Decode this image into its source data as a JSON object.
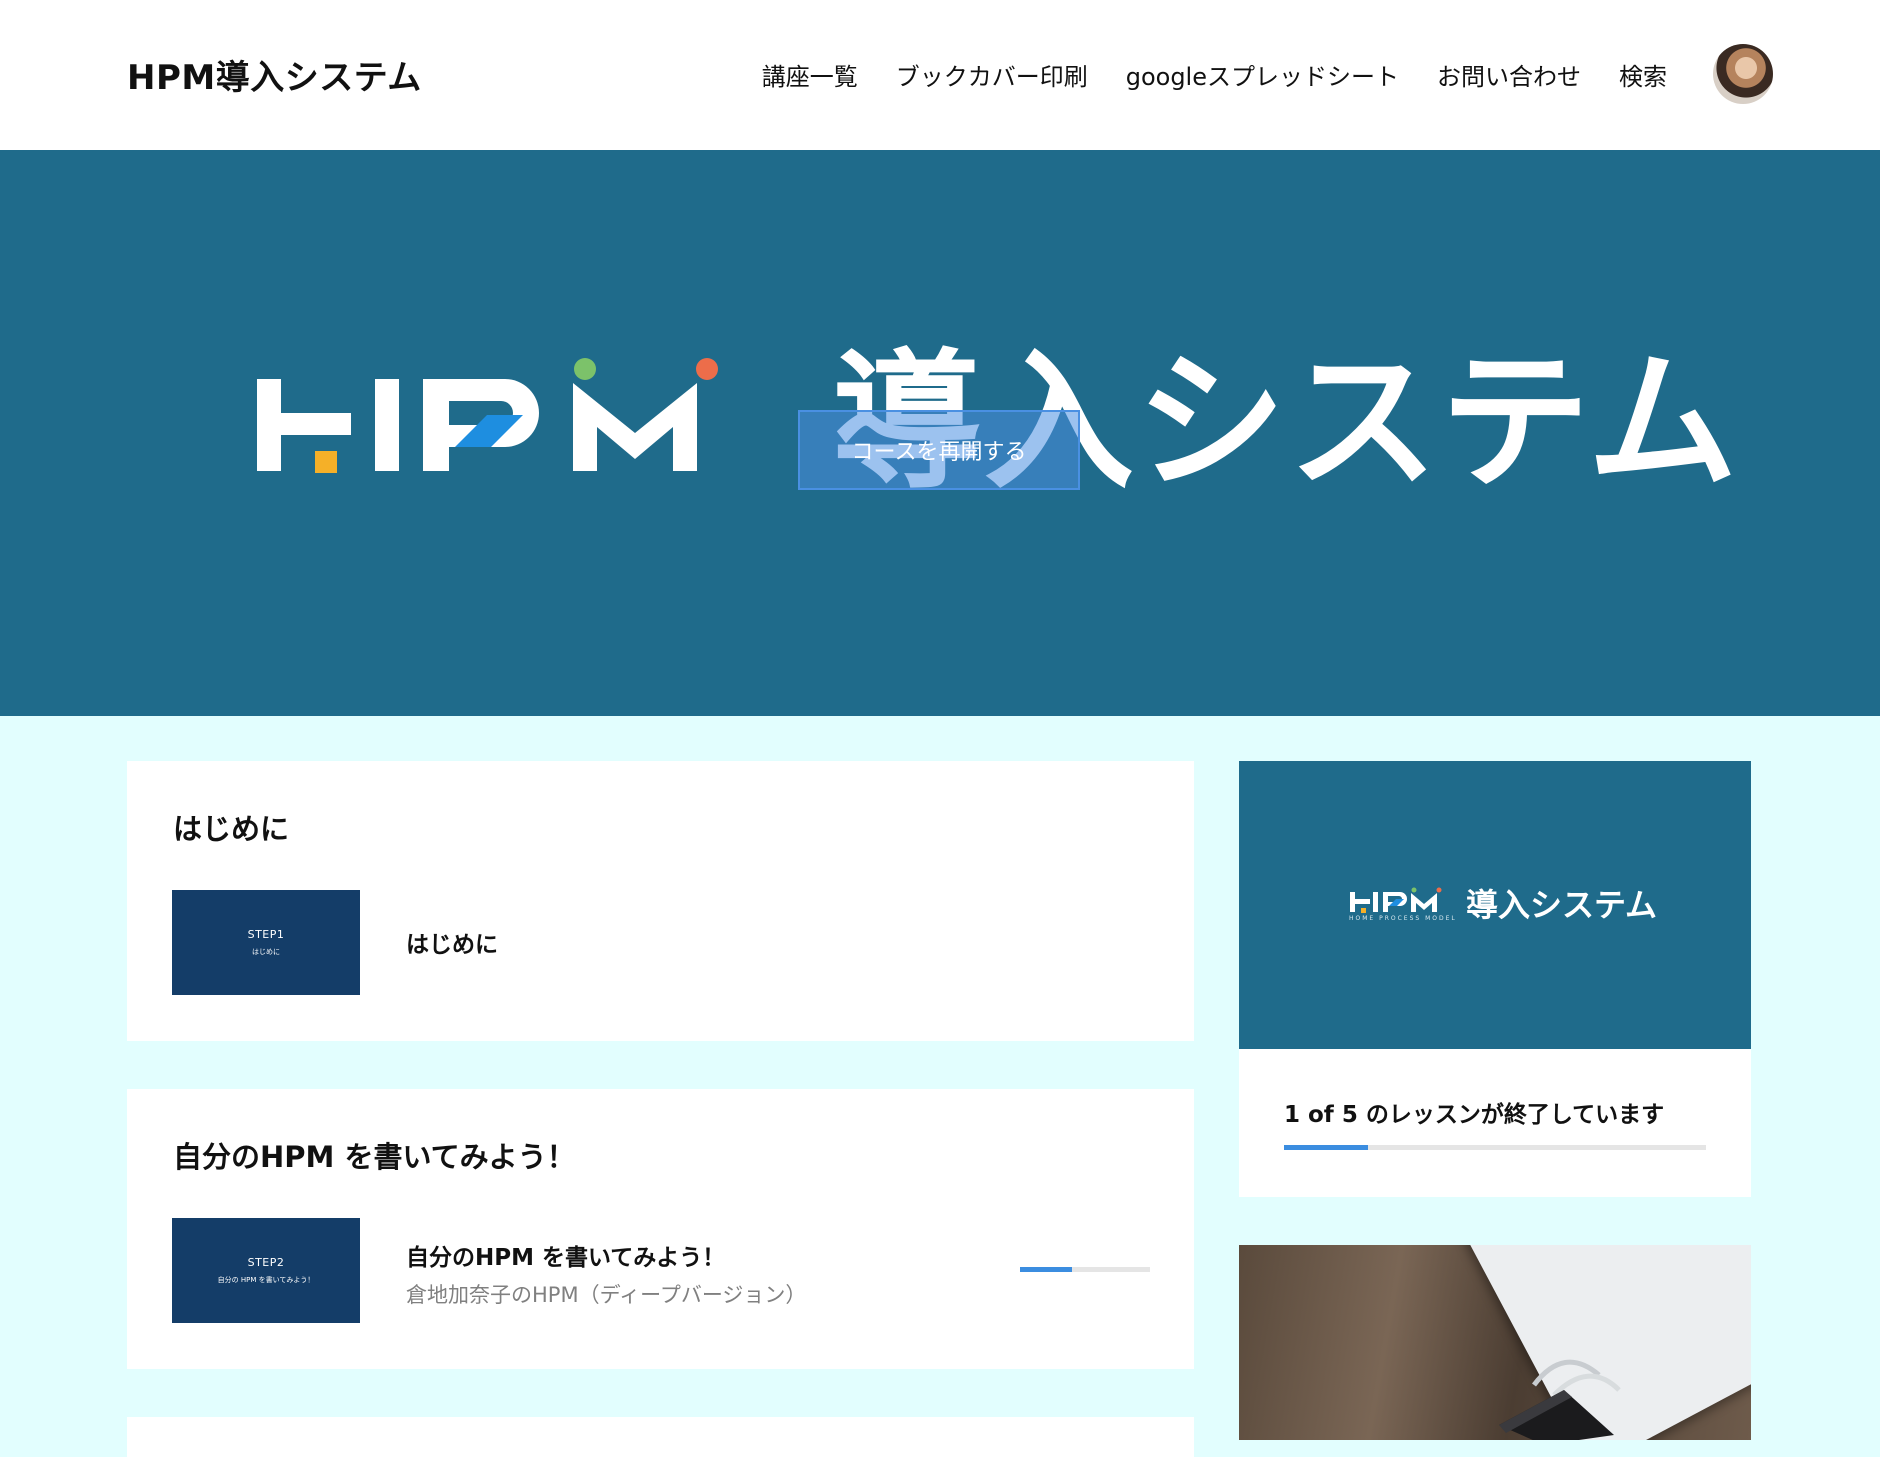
{
  "header": {
    "site_title": "HPM導入システム",
    "nav": [
      "講座一覧",
      "ブックカバー印刷",
      "googleスプレッドシート",
      "お問い合わせ",
      "検索"
    ]
  },
  "hero": {
    "logo_jp": "導入システム",
    "resume_button": "コースを再開する"
  },
  "sections": [
    {
      "title": "はじめに",
      "thumb_step": "STEP1",
      "thumb_caption": "はじめに",
      "lesson_title": "はじめに"
    },
    {
      "title": "自分のHPM を書いてみよう！",
      "thumb_step": "STEP2",
      "thumb_caption": "自分の HPM を書いてみよう！",
      "lesson_title": "自分のHPM を書いてみよう！",
      "lesson_sub": "倉地加奈子のHPM（ディープバージョン）",
      "lesson_progress": 0.4
    }
  ],
  "sidebar": {
    "image_jp": "導入システム",
    "image_logo_sub": "HOME PROCESS MODEL",
    "progress_text": "1 of 5 のレッスンが終了しています",
    "progress_fraction": 0.2
  },
  "colors": {
    "hero_bg": "#1f6b8b",
    "page_bg": "#e2fefe",
    "accent": "#3b8de0",
    "thumb_bg": "#143d68"
  }
}
